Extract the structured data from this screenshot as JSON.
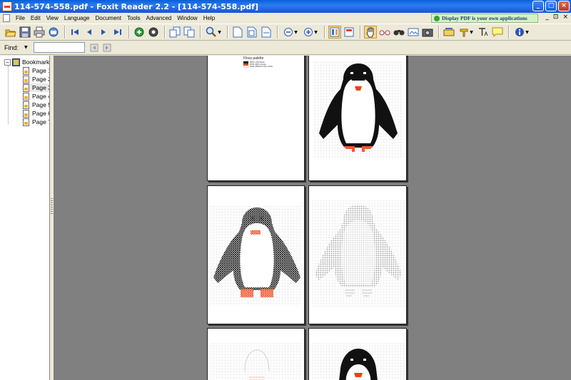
{
  "window": {
    "title": "114-574-558.pdf - Foxit Reader 2.2 - [114-574-558.pdf]",
    "controls": [
      "_",
      "□",
      "×"
    ]
  },
  "menubar": {
    "items": [
      "File",
      "Edit",
      "View",
      "Language",
      "Document",
      "Tools",
      "Advanced",
      "Window",
      "Help"
    ],
    "promo": "Display PDF is your own applications",
    "mdi_controls": [
      "_",
      "⊡",
      "×"
    ]
  },
  "toolbar": {
    "icons": [
      "open-icon",
      "save-icon",
      "print-icon",
      "email-icon",
      "first-page-icon",
      "previous-page-icon",
      "next-page-icon",
      "last-page-icon",
      "go-back-icon",
      "go-forward-icon",
      "rotate-left-icon",
      "rotate-right-icon",
      "zoom-icon",
      "actual-size-icon",
      "fit-page-icon",
      "fit-width-icon",
      "zoom-out-icon",
      "zoom-in-icon",
      "thumbnails-icon",
      "single-page-icon",
      "hand-tool-icon",
      "loupe-icon",
      "find-icon",
      "snapshot-icon",
      "camera-icon",
      "typewriter-icon",
      "highlight-icon",
      "text-tool-icon",
      "comment-icon",
      "info-icon"
    ]
  },
  "findbar": {
    "label": "Find:",
    "value": "",
    "prev_icon": "find-previous-icon",
    "next_icon": "find-next-icon"
  },
  "sidebar": {
    "root_label": "Bookmark",
    "pages": [
      "Page 1",
      "Page 2",
      "Page 3",
      "Page 4",
      "Page 5",
      "Page 6",
      "Page 7"
    ],
    "selected_index": 2
  },
  "document": {
    "palette_heading": "Floss palette",
    "palette_rows": [
      "DMC-310 black",
      "DMC-946 orange",
      "DMC-B5200 snow white"
    ],
    "pages": [
      {
        "name": "floss-palette-page",
        "content": "palette"
      },
      {
        "name": "penguin-pattern-page",
        "content": "penguin-color"
      },
      {
        "name": "penguin-cross-page",
        "content": "penguin-cross"
      },
      {
        "name": "penguin-symbol-page",
        "content": "penguin-symbols"
      },
      {
        "name": "penguin-detail-page-left",
        "content": "partial-light"
      },
      {
        "name": "penguin-detail-page-right",
        "content": "partial-head"
      }
    ]
  },
  "colors": {
    "doc_background": "#808080",
    "penguin_black": "#111111",
    "beak_orange": "#f04010",
    "feet_orange": "#f25a2a",
    "grid": "#c8c8c8"
  }
}
